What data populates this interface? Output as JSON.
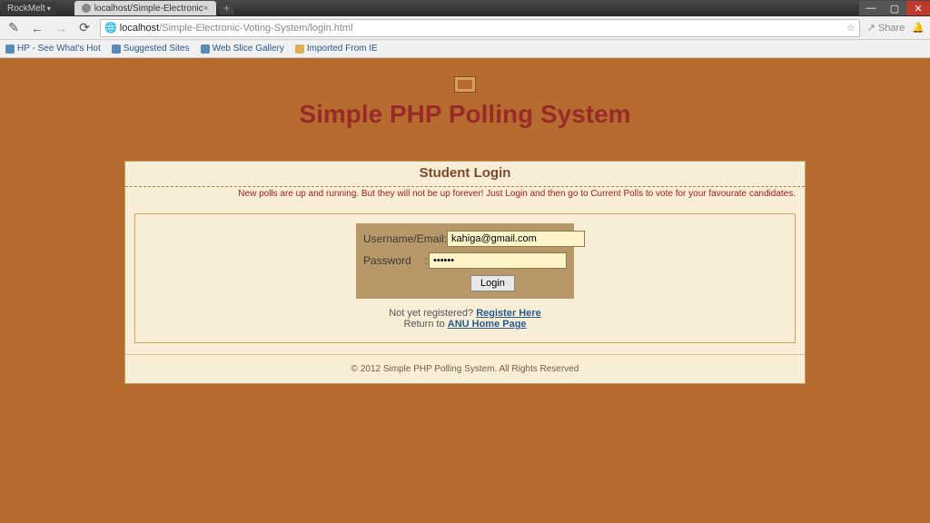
{
  "browser": {
    "menu_label": "RockMelt",
    "tab_title": "localhost/Simple-Electronic",
    "url_host": "localhost",
    "url_path": "/Simple-Electronic-Voting-System/login.html",
    "share_label": "Share",
    "bookmarks": [
      "HP - See What's Hot",
      "Suggested Sites",
      "Web Slice Gallery",
      "Imported From IE"
    ]
  },
  "page": {
    "title": "Simple PHP Polling System",
    "panel_title": "Student Login",
    "notice": "New polls are up and running. But they will not be up forever! Just Login and then go to Current Polls to vote for your favourate candidates.",
    "username_label": "Username/Email",
    "password_label": "Password",
    "username_value": "kahiga@gmail.com",
    "password_value": "••••••",
    "login_button": "Login",
    "register_prompt": "Not yet registered? ",
    "register_link": "Register Here",
    "return_prompt": "Return to ",
    "home_link": "ANU Home Page",
    "footer": "© 2012 Simple PHP Polling System. All Rights Reserved"
  }
}
